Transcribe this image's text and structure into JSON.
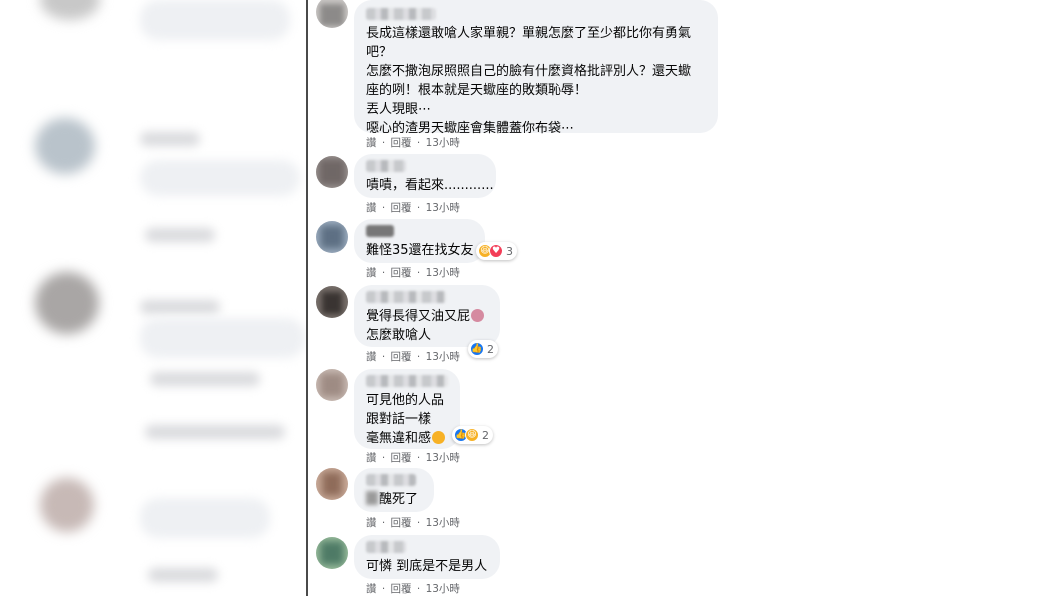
{
  "comments": [
    {
      "lines": [
        "長成這樣還敢嗆人家單親？單親怎麼了至少都比你有勇氣",
        "吧？",
        "怎麼不撒泡尿照照自己的臉有什麼資格批評別人？還天蠍",
        "座的咧！根本就是天蠍座的敗類恥辱！",
        "丟人現眼⋯",
        "噁心的渣男天蠍座會集體蓋你布袋⋯"
      ],
      "actions": {
        "like": "讚",
        "dot": "·",
        "reply": "回覆",
        "time": "13小時"
      }
    },
    {
      "lines": [
        "嘖嘖，看起來............"
      ],
      "actions": {
        "like": "讚",
        "dot": "·",
        "reply": "回覆",
        "time": "13小時"
      }
    },
    {
      "lines": [
        "難怪35還在找女友"
      ],
      "reaction_count": "3",
      "actions": {
        "like": "讚",
        "dot": "·",
        "reply": "回覆",
        "time": "13小時"
      }
    },
    {
      "lines": [
        "覺得長得又油又屁",
        "怎麼敢嗆人"
      ],
      "reaction_count": "2",
      "actions": {
        "like": "讚",
        "dot": "·",
        "reply": "回覆",
        "time": "13小時"
      }
    },
    {
      "lines": [
        "可見他的人品",
        "跟對話一樣",
        "毫無違和感"
      ],
      "reaction_count": "2",
      "actions": {
        "like": "讚",
        "dot": "·",
        "reply": "回覆",
        "time": "13小時"
      }
    },
    {
      "lines": [
        "醜死了"
      ],
      "actions": {
        "like": "讚",
        "dot": "·",
        "reply": "回覆",
        "time": "13小時"
      }
    },
    {
      "lines": [
        "可憐 到底是不是男人"
      ],
      "actions": {
        "like": "讚",
        "dot": "·",
        "reply": "回覆",
        "time": "13小時"
      }
    }
  ],
  "icons": {
    "like": "like-reaction-icon",
    "haha": "haha-reaction-icon",
    "love": "love-reaction-icon",
    "woman": "woman-emoji-icon",
    "sad": "sad-emoji-icon"
  },
  "colors": {
    "bubble": "#f0f2f5",
    "meta": "#65676b",
    "like_blue": "#1877f2",
    "love_red": "#f33e58",
    "haha_yellow": "#f7b125"
  }
}
